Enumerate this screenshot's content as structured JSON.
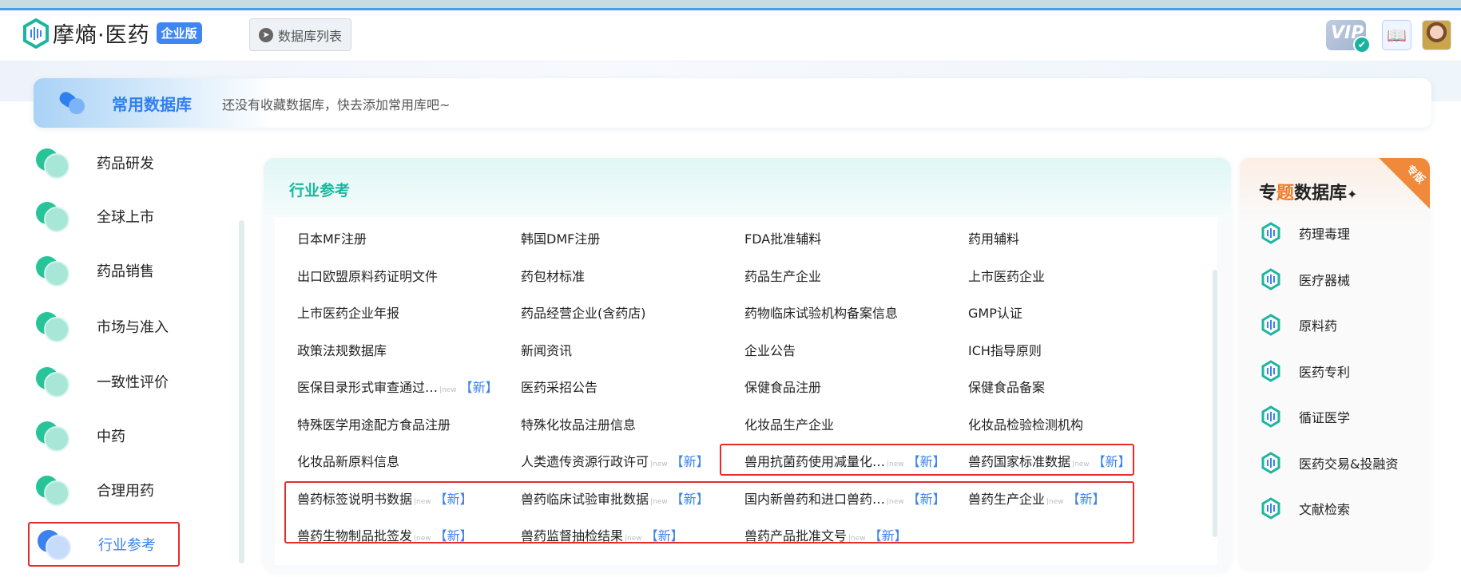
{
  "header": {
    "logo_text": "摩熵·医药",
    "logo_badge": "企业版",
    "db_list_button": "数据库列表",
    "vip_label": "VIP"
  },
  "common": {
    "title": "常用数据库",
    "empty_text": "还没有收藏数据库，快去添加常用库吧~"
  },
  "sidebar": {
    "items": [
      {
        "label": "药品研发"
      },
      {
        "label": "全球上市"
      },
      {
        "label": "药品销售"
      },
      {
        "label": "市场与准入"
      },
      {
        "label": "一致性评价"
      },
      {
        "label": "中药"
      },
      {
        "label": "合理用药"
      },
      {
        "label": "行业参考",
        "active": true
      }
    ]
  },
  "main": {
    "title": "行业参考",
    "new_tag": "【新】",
    "rows": [
      [
        "日本MF注册",
        "韩国DMF注册",
        "FDA批准辅料",
        "药用辅料"
      ],
      [
        "出口欧盟原料药证明文件",
        "药包材标准",
        "药品生产企业",
        "上市医药企业"
      ],
      [
        "上市医药企业年报",
        "药品经营企业(含药店)",
        "药物临床试验机构备案信息",
        "GMP认证"
      ],
      [
        "政策法规数据库",
        "新闻资讯",
        "企业公告",
        "ICH指导原则"
      ],
      [
        "医保目录形式审查通过…|new",
        "医药采招公告",
        "保健食品注册",
        "保健食品备案"
      ],
      [
        "特殊医学用途配方食品注册",
        "特殊化妆品注册信息",
        "化妆品生产企业",
        "化妆品检验检测机构"
      ],
      [
        "化妆品新原料信息",
        "人类遗传资源行政许可|new",
        "兽用抗菌药使用减量化…|new",
        "兽药国家标准数据|new"
      ],
      [
        "兽药标签说明书数据|new",
        "兽药临床试验审批数据|new",
        "国内新兽药和进口兽药…|new",
        "兽药生产企业|new"
      ],
      [
        "兽药生物制品批签发|new",
        "兽药监督抽检结果|new",
        "兽药产品批准文号|new",
        ""
      ]
    ]
  },
  "topic": {
    "title_a": "专",
    "title_hl": "题",
    "title_b": "数据库",
    "sparkle": "✦",
    "ribbon": "专版",
    "items": [
      {
        "label": "药理毒理"
      },
      {
        "label": "医疗器械"
      },
      {
        "label": "原料药"
      },
      {
        "label": "医药专利"
      },
      {
        "label": "循证医学"
      },
      {
        "label": "医药交易&投融资"
      },
      {
        "label": "文献检索"
      }
    ]
  },
  "colors": {
    "accent_blue": "#3b82f0",
    "teal": "#1db5a0",
    "highlight_red": "#e62b2b",
    "orange": "#f08a3a"
  }
}
